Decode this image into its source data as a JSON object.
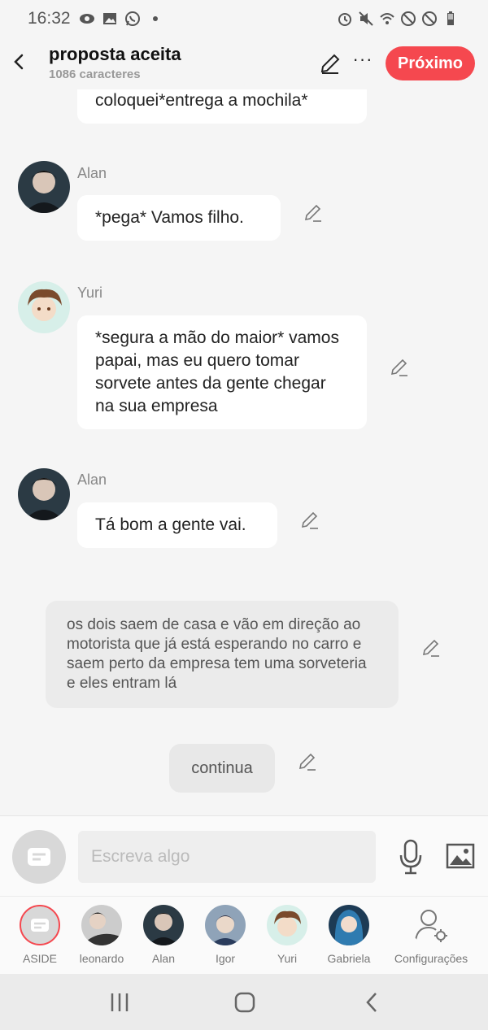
{
  "status_bar": {
    "time": "16:32",
    "left_icons": [
      "eye-icon",
      "gallery-icon",
      "whatsapp-icon",
      "dot-icon"
    ],
    "right_icons": [
      "alarm-icon",
      "mute-icon",
      "wifi-icon",
      "blocked-icon",
      "blocked-icon",
      "battery-icon"
    ]
  },
  "header": {
    "title": "proposta aceita",
    "subtitle": "1086 caracteres",
    "more_label": "···",
    "next_label": "Próximo",
    "accent_color": "#f5484f"
  },
  "messages": [
    {
      "type": "bubble",
      "text": "coloquei*entrega a mochila*"
    },
    {
      "type": "character",
      "name": "Alan",
      "text": "*pega* Vamos filho."
    },
    {
      "type": "character",
      "name": "Yuri",
      "text": "*segura a mão do maior* vamos papai, mas eu quero tomar sorvete antes da gente chegar na sua empresa"
    },
    {
      "type": "character",
      "name": "Alan",
      "text": "Tá bom a gente vai."
    },
    {
      "type": "narration",
      "text": "os dois saem de casa e vão em direção ao motorista que já está esperando no carro e saem perto da empresa tem uma sorveteria e eles entram lá"
    },
    {
      "type": "chip",
      "text": "continua"
    }
  ],
  "input": {
    "placeholder": "Escreva algo"
  },
  "characters": [
    {
      "label": "ASIDE"
    },
    {
      "label": "leonardo"
    },
    {
      "label": "Alan"
    },
    {
      "label": "Igor"
    },
    {
      "label": "Yuri"
    },
    {
      "label": "Gabriela"
    },
    {
      "label": "Configurações"
    }
  ]
}
